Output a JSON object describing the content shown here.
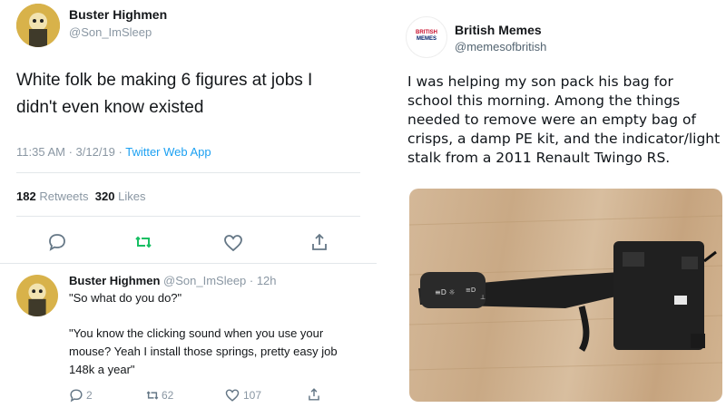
{
  "left_tweet": {
    "name": "Buster Highmen",
    "handle": "@Son_ImSleep",
    "body": "White folk be making 6 figures at jobs I didn't even know existed",
    "meta_time": "11:35 AM · 3/12/19 · ",
    "meta_app": "Twitter Web App",
    "retweets_count": "182",
    "retweets_label": "Retweets",
    "likes_count": "320",
    "likes_label": "Likes",
    "action_icons": [
      "reply-icon",
      "retweet-icon",
      "like-icon",
      "share-icon"
    ],
    "accent_color": "#1da1f2",
    "retweet_color": "#17bf63"
  },
  "reply_tweet": {
    "name": "Buster Highmen",
    "handle_time": "@Son_ImSleep · 12h",
    "line1": "\"So what do you do?\"",
    "line2": "\"You know the clicking sound when you use your mouse? Yeah I install those springs, pretty easy job 148k a year\"",
    "replies": "2",
    "retweets": "62",
    "likes": "107"
  },
  "right_tweet": {
    "name": "British Memes",
    "handle": "@memesofbritish",
    "avatar_text_top": "BRITISH",
    "avatar_text_bottom": "MEMES",
    "body": "I was helping my son pack his bag for school this morning. Among the things needed to remove were an empty bag of crisps, a damp PE kit, and the indicator/light stalk from a 2011 Renault Twingo RS.",
    "image_subject": "indicator-light-stalk-photo"
  }
}
